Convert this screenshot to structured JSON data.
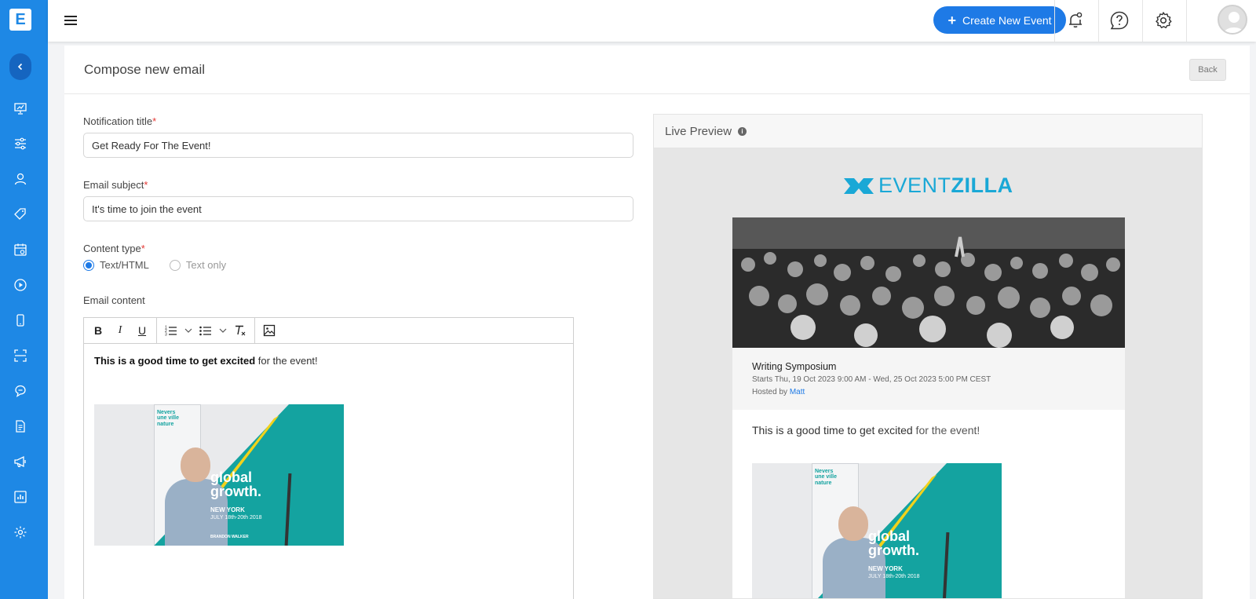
{
  "sidebar": {
    "logo_letter": "E",
    "items": [
      "dashboard",
      "settings-sliders",
      "attendees",
      "tickets",
      "calendar",
      "media",
      "mobile",
      "check-in",
      "communications",
      "reports-doc",
      "marketing",
      "analytics",
      "settings"
    ]
  },
  "topbar": {
    "create_label": "Create New Event"
  },
  "page": {
    "title": "Compose new email",
    "back_label": "Back"
  },
  "form": {
    "notification_title_label": "Notification title",
    "notification_title_value": "Get Ready For The Event!",
    "email_subject_label": "Email subject",
    "email_subject_value": "It's time to join the event",
    "content_type_label": "Content type",
    "content_type_options": [
      "Text/HTML",
      "Text only"
    ],
    "content_type_selected": "Text/HTML",
    "email_content_label": "Email content",
    "required_mark": "*",
    "body_bold": "This is a good time to get excited",
    "body_rest": " for the event!"
  },
  "poster": {
    "tagline_lines": [
      "Nevers",
      "une ville",
      "nature"
    ],
    "headline_lines": [
      "global",
      "growth."
    ],
    "city": "NEW YORK",
    "dates": "JULY 18th-20th 2018",
    "speaker": "BRANDON WALKER"
  },
  "preview": {
    "title": "Live Preview",
    "brand_light": "EVENT",
    "brand_bold": "ZILLA",
    "event_name": "Writing Symposium",
    "event_dates": "Starts Thu, 19 Oct 2023 9:00 AM - Wed, 25 Oct 2023 5:00 PM CEST",
    "hosted_by_prefix": "Hosted by ",
    "host_name": "Matt",
    "message_bold": "This is a good time to get excited",
    "message_rest": " for the event!"
  },
  "colors": {
    "primary": "#1e88e5",
    "button": "#1e7ae6",
    "teal": "#14a3a0",
    "required": "#e53935"
  }
}
